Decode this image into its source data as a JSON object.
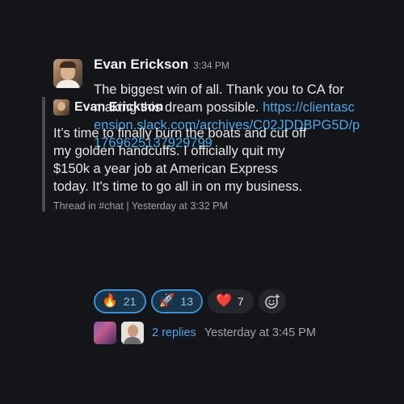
{
  "message": {
    "author": "Evan Erickson",
    "time": "3:34 PM",
    "text": "The biggest win of all. Thank you to CA for making this dream possible.",
    "link": "https://clientascension.slack.com/archives/C02JDDBPG5D/p1769625137929799"
  },
  "quote": {
    "author": "Evan Erickson",
    "text": "It’s time to finally burn the boats and cut off my golden handcuffs. I officially quit my $150k a year job at American Express today. It's time to go all in on my business.",
    "meta": "Thread in #chat | Yesterday at 3:32 PM"
  },
  "reactions": [
    {
      "emoji": "🔥",
      "count": "21",
      "active": true
    },
    {
      "emoji": "🚀",
      "count": "13",
      "active": true
    },
    {
      "emoji": "❤️",
      "count": "7",
      "active": false
    }
  ],
  "replies": {
    "count_label": "2 replies",
    "time": "Yesterday at 3:45 PM"
  },
  "colors": {
    "background": "#141519",
    "link": "#4ea7e8",
    "reaction_active_border": "#3c8fd0"
  }
}
